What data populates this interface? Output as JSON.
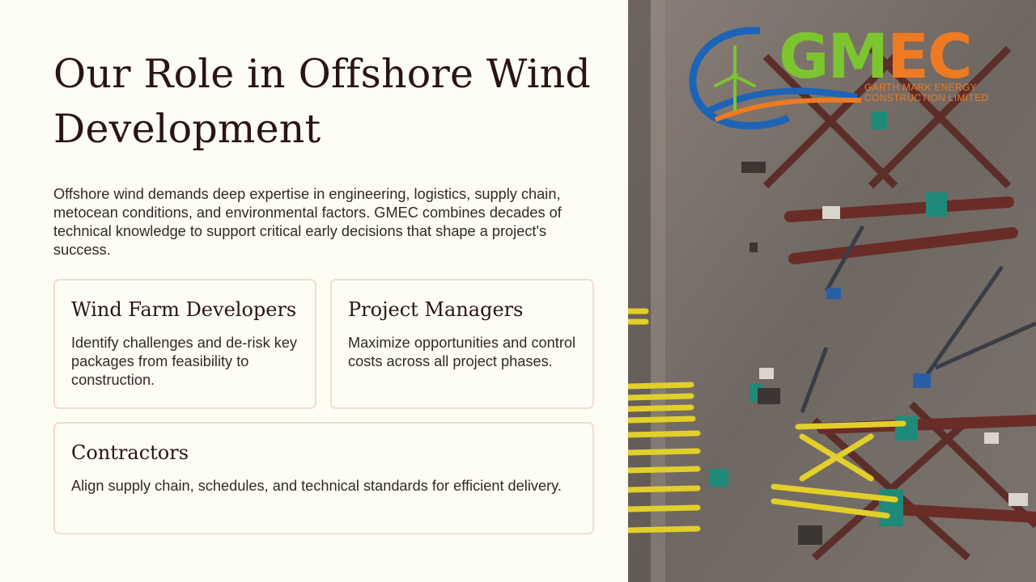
{
  "slide": {
    "title": "Our Role in Offshore Wind Development",
    "intro": "Offshore wind demands deep expertise in engineering, logistics, supply chain, metocean conditions, and environmental factors. GMEC combines decades of technical knowledge to support critical early decisions that shape a project's success."
  },
  "cards": [
    {
      "title": "Wind Farm Developers",
      "body": "Identify challenges and de-risk key packages from feasibility to construction."
    },
    {
      "title": "Project Managers",
      "body": "Maximize opportunities and control costs across all project phases."
    },
    {
      "title": "Contractors",
      "body": "Align supply chain, schedules, and technical standards for efficient delivery."
    }
  ],
  "logo": {
    "letters_green": "GM",
    "letters_orange": "EC",
    "subtitle_line1": "Garth Mark Energy",
    "subtitle_line2": "Construction Limited",
    "colors": {
      "green": "#7dc52f",
      "orange": "#ee7a22",
      "blue": "#1d64b6"
    }
  },
  "photo": {
    "description_icon": "aerial-construction-yard-image"
  },
  "colors": {
    "background": "#fdfdf3",
    "card_border": "#f2ddd3",
    "text": "#352727"
  }
}
